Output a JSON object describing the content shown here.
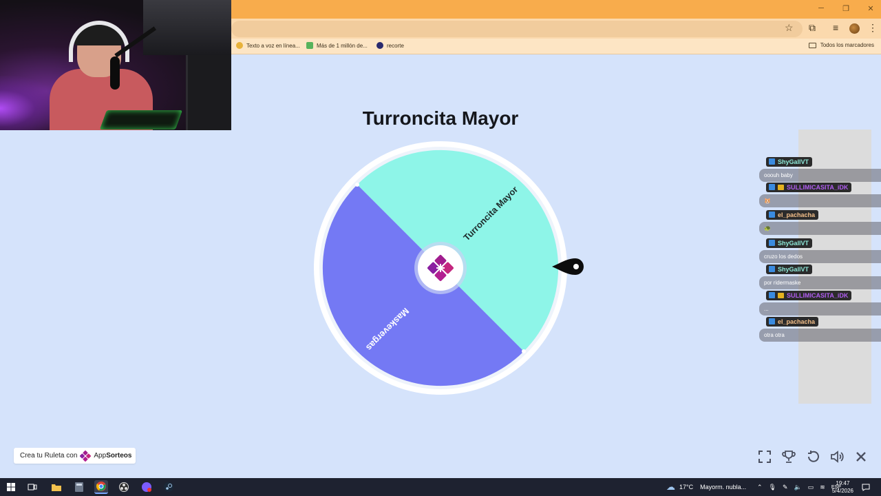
{
  "browser": {
    "bookmarks": [
      {
        "label": "Texto a voz en línea...",
        "color": "#e8b23a"
      },
      {
        "label": "Más de 1 millón de...",
        "color": "#58b35c"
      },
      {
        "label": "recorte",
        "color": "#2a2a6e"
      }
    ],
    "bookmarks_folder": "Todos los marcadores"
  },
  "webcam": {
    "description_icon": "webcam-feed"
  },
  "wheel": {
    "title": "Turroncita Mayor",
    "segments": [
      {
        "label": "Turroncita Mayor",
        "color": "#8ef5e8"
      },
      {
        "label": "Maskevergas",
        "color": "#7479f4"
      }
    ],
    "center_logo_color": "#a11d8f"
  },
  "chat": [
    {
      "user": "ShyGallVT",
      "user_color": "#8ee9d9",
      "text": "ooouh baby",
      "extra_badge": false
    },
    {
      "user": "SULLIMICASITA_iDK",
      "user_color": "#b05df0",
      "text": "🐹",
      "extra_badge": true
    },
    {
      "user": "el_pachacha",
      "user_color": "#f5c08a",
      "text": "🐢",
      "extra_badge": false
    },
    {
      "user": "ShyGallVT",
      "user_color": "#8ee9d9",
      "text": "cruzo los dedos",
      "extra_badge": false
    },
    {
      "user": "ShyGallVT",
      "user_color": "#8ee9d9",
      "text": "por ridermaske",
      "extra_badge": false
    },
    {
      "user": "SULLIMICASITA_iDK",
      "user_color": "#b05df0",
      "text": "...",
      "extra_badge": true
    },
    {
      "user": "el_pachacha",
      "user_color": "#f5c08a",
      "text": "otra otra",
      "extra_badge": false
    }
  ],
  "promo": {
    "prefix": "Crea tu Ruleta con",
    "brand_a": "App",
    "brand_b": "Sorteos"
  },
  "controls": [
    "fullscreen-icon",
    "trophy-icon",
    "reset-icon",
    "volume-icon",
    "close-icon"
  ],
  "taskbar": {
    "weather_temp": "17°C",
    "weather_desc": "Mayorm. nubla...",
    "lang": "ESP",
    "time": "19:47",
    "date": "5/4/2026"
  }
}
